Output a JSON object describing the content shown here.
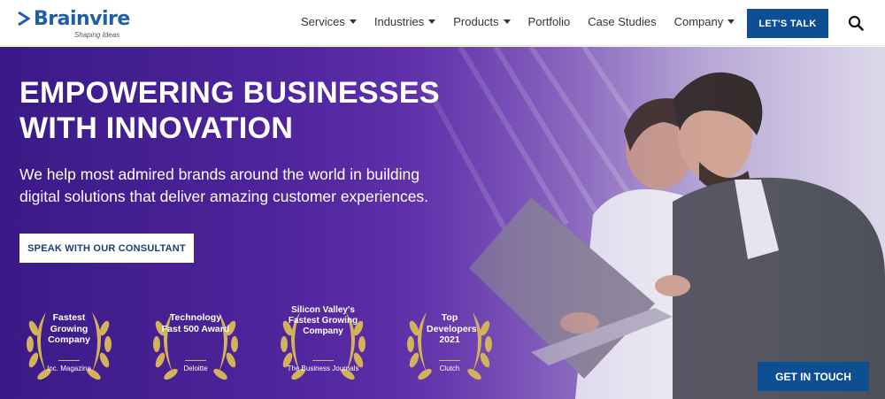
{
  "brand": {
    "name": "Brainvire",
    "tagline": "Shaping Ideas"
  },
  "nav": {
    "items": [
      {
        "label": "Services",
        "dropdown": true
      },
      {
        "label": "Industries",
        "dropdown": true
      },
      {
        "label": "Products",
        "dropdown": true
      },
      {
        "label": "Portfolio",
        "dropdown": false
      },
      {
        "label": "Case Studies",
        "dropdown": false
      },
      {
        "label": "Company",
        "dropdown": true
      }
    ],
    "cta_label": "LET'S TALK",
    "search_icon": "search-icon"
  },
  "hero": {
    "headline_line1": "EMPOWERING BUSINESSES",
    "headline_line2": "WITH INNOVATION",
    "subtext_line1": "We help most admired brands around the world in building",
    "subtext_line2": "digital solutions that deliver amazing customer experiences.",
    "consult_label": "SPEAK WITH OUR CONSULTANT"
  },
  "awards": [
    {
      "title": "Fastest Growing Company",
      "source": "Inc. Magazine"
    },
    {
      "title": "Technology Fast 500 Award",
      "source": "Deloitte"
    },
    {
      "title": "Silicon Valley's Fastest Growing Company",
      "source": "The Business Journals"
    },
    {
      "title": "Top Developers 2021",
      "source": "Clutch"
    }
  ],
  "get_in_touch_label": "GET IN TOUCH",
  "colors": {
    "brand_blue": "#0e4f94",
    "hero_purple": "#4a2299",
    "laurel_gold": "#d4b25a"
  }
}
